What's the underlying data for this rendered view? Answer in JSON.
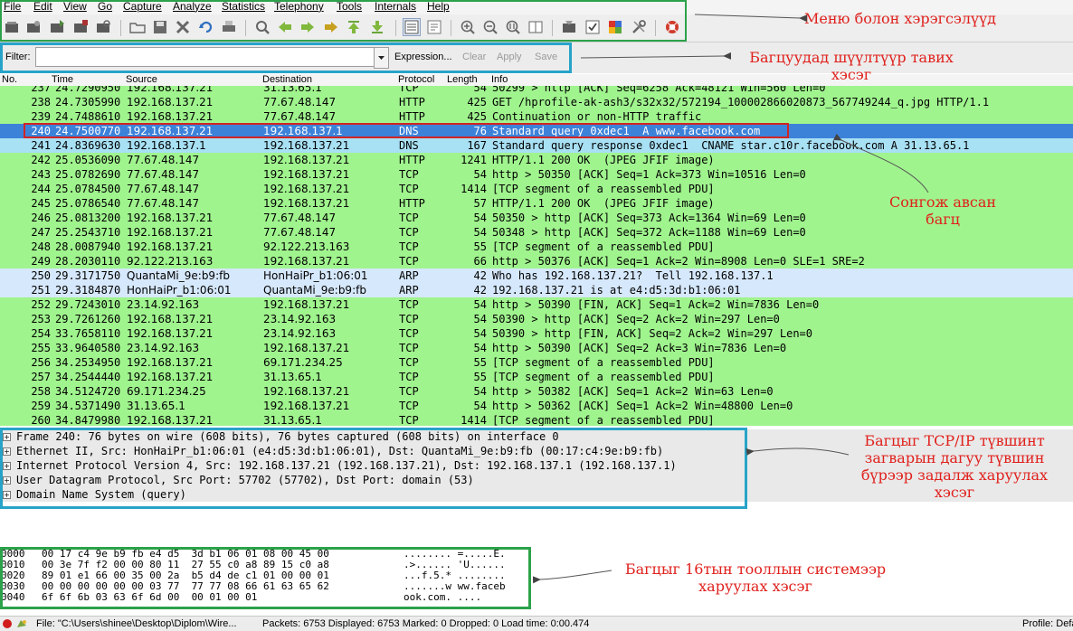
{
  "menu": [
    "File",
    "Edit",
    "View",
    "Go",
    "Capture",
    "Analyze",
    "Statistics",
    "Telephony",
    "Tools",
    "Internals",
    "Help"
  ],
  "toolbar_icons": [
    "interface-list-icon",
    "capture-options-icon",
    "start-capture-icon",
    "stop-capture-icon",
    "restart-capture-icon",
    "open-file-icon",
    "save-file-icon",
    "close-file-icon",
    "reload-icon",
    "print-icon",
    "find-packet-icon",
    "go-back-icon",
    "go-forward-icon",
    "go-to-packet-icon",
    "go-first-icon",
    "go-last-icon",
    "colorize-icon",
    "auto-scroll-icon",
    "zoom-in-icon",
    "zoom-out-icon",
    "zoom-normal-icon",
    "resize-columns-icon",
    "capture-filters-icon",
    "display-filters-icon",
    "coloring-rules-icon",
    "preferences-icon",
    "help-icon"
  ],
  "filter": {
    "label": "Filter:",
    "value": "",
    "expression": "Expression...",
    "clear": "Clear",
    "apply": "Apply",
    "save": "Save"
  },
  "columns": [
    "No.",
    "Time",
    "Source",
    "Destination",
    "Protocol",
    "Length",
    "Info"
  ],
  "packets": [
    {
      "no": "237",
      "time": "24.7290950",
      "src": "192.168.137.21",
      "dst": "31.13.65.1",
      "proto": "TCP",
      "len": "54",
      "info": "50299 > http [ACK] Seq=6258 Ack=48121 Win=560 Len=0",
      "bg": "green"
    },
    {
      "no": "238",
      "time": "24.7305990",
      "src": "192.168.137.21",
      "dst": "77.67.48.147",
      "proto": "HTTP",
      "len": "425",
      "info": "GET /hprofile-ak-ash3/s32x32/572194_100002866020873_567749244_q.jpg HTTP/1.1",
      "bg": "green"
    },
    {
      "no": "239",
      "time": "24.7488610",
      "src": "192.168.137.21",
      "dst": "77.67.48.147",
      "proto": "HTTP",
      "len": "425",
      "info": "Continuation or non-HTTP traffic",
      "bg": "green"
    },
    {
      "no": "240",
      "time": "24.7500770",
      "src": "192.168.137.21",
      "dst": "192.168.137.1",
      "proto": "DNS",
      "len": "76",
      "info": "Standard query 0xdec1  A www.facebook.com",
      "bg": "selected"
    },
    {
      "no": "241",
      "time": "24.8369630",
      "src": "192.168.137.1",
      "dst": "192.168.137.21",
      "proto": "DNS",
      "len": "167",
      "info": "Standard query response 0xdec1  CNAME star.c10r.facebook.com A 31.13.65.1",
      "bg": "cyan"
    },
    {
      "no": "242",
      "time": "25.0536090",
      "src": "77.67.48.147",
      "dst": "192.168.137.21",
      "proto": "HTTP",
      "len": "1241",
      "info": "HTTP/1.1 200 OK  (JPEG JFIF image)",
      "bg": "green"
    },
    {
      "no": "243",
      "time": "25.0782690",
      "src": "77.67.48.147",
      "dst": "192.168.137.21",
      "proto": "TCP",
      "len": "54",
      "info": "http > 50350 [ACK] Seq=1 Ack=373 Win=10516 Len=0",
      "bg": "green"
    },
    {
      "no": "244",
      "time": "25.0784500",
      "src": "77.67.48.147",
      "dst": "192.168.137.21",
      "proto": "TCP",
      "len": "1414",
      "info": "[TCP segment of a reassembled PDU]",
      "bg": "green"
    },
    {
      "no": "245",
      "time": "25.0786540",
      "src": "77.67.48.147",
      "dst": "192.168.137.21",
      "proto": "HTTP",
      "len": "57",
      "info": "HTTP/1.1 200 OK  (JPEG JFIF image)",
      "bg": "green"
    },
    {
      "no": "246",
      "time": "25.0813200",
      "src": "192.168.137.21",
      "dst": "77.67.48.147",
      "proto": "TCP",
      "len": "54",
      "info": "50350 > http [ACK] Seq=373 Ack=1364 Win=69 Len=0",
      "bg": "green"
    },
    {
      "no": "247",
      "time": "25.2543710",
      "src": "192.168.137.21",
      "dst": "77.67.48.147",
      "proto": "TCP",
      "len": "54",
      "info": "50348 > http [ACK] Seq=372 Ack=1188 Win=69 Len=0",
      "bg": "green"
    },
    {
      "no": "248",
      "time": "28.0087940",
      "src": "192.168.137.21",
      "dst": "92.122.213.163",
      "proto": "TCP",
      "len": "55",
      "info": "[TCP segment of a reassembled PDU]",
      "bg": "green"
    },
    {
      "no": "249",
      "time": "28.2030110",
      "src": "92.122.213.163",
      "dst": "192.168.137.21",
      "proto": "TCP",
      "len": "66",
      "info": "http > 50376 [ACK] Seq=1 Ack=2 Win=8908 Len=0 SLE=1 SRE=2",
      "bg": "green"
    },
    {
      "no": "250",
      "time": "29.3171750",
      "src": "QuantaMi_9e:b9:fb",
      "dst": "HonHaiPr_b1:06:01",
      "proto": "ARP",
      "len": "42",
      "info": "Who has 192.168.137.21?  Tell 192.168.137.1",
      "bg": "arp"
    },
    {
      "no": "251",
      "time": "29.3184870",
      "src": "HonHaiPr_b1:06:01",
      "dst": "QuantaMi_9e:b9:fb",
      "proto": "ARP",
      "len": "42",
      "info": "192.168.137.21 is at e4:d5:3d:b1:06:01",
      "bg": "arp"
    },
    {
      "no": "252",
      "time": "29.7243010",
      "src": "23.14.92.163",
      "dst": "192.168.137.21",
      "proto": "TCP",
      "len": "54",
      "info": "http > 50390 [FIN, ACK] Seq=1 Ack=2 Win=7836 Len=0",
      "bg": "green"
    },
    {
      "no": "253",
      "time": "29.7261260",
      "src": "192.168.137.21",
      "dst": "23.14.92.163",
      "proto": "TCP",
      "len": "54",
      "info": "50390 > http [ACK] Seq=2 Ack=2 Win=297 Len=0",
      "bg": "green"
    },
    {
      "no": "254",
      "time": "33.7658110",
      "src": "192.168.137.21",
      "dst": "23.14.92.163",
      "proto": "TCP",
      "len": "54",
      "info": "50390 > http [FIN, ACK] Seq=2 Ack=2 Win=297 Len=0",
      "bg": "green"
    },
    {
      "no": "255",
      "time": "33.9640580",
      "src": "23.14.92.163",
      "dst": "192.168.137.21",
      "proto": "TCP",
      "len": "54",
      "info": "http > 50390 [ACK] Seq=2 Ack=3 Win=7836 Len=0",
      "bg": "green"
    },
    {
      "no": "256",
      "time": "34.2534950",
      "src": "192.168.137.21",
      "dst": "69.171.234.25",
      "proto": "TCP",
      "len": "55",
      "info": "[TCP segment of a reassembled PDU]",
      "bg": "green"
    },
    {
      "no": "257",
      "time": "34.2544440",
      "src": "192.168.137.21",
      "dst": "31.13.65.1",
      "proto": "TCP",
      "len": "55",
      "info": "[TCP segment of a reassembled PDU]",
      "bg": "green"
    },
    {
      "no": "258",
      "time": "34.5124720",
      "src": "69.171.234.25",
      "dst": "192.168.137.21",
      "proto": "TCP",
      "len": "54",
      "info": "http > 50382 [ACK] Seq=1 Ack=2 Win=63 Len=0",
      "bg": "green"
    },
    {
      "no": "259",
      "time": "34.5371490",
      "src": "31.13.65.1",
      "dst": "192.168.137.21",
      "proto": "TCP",
      "len": "54",
      "info": "http > 50362 [ACK] Seq=1 Ack=2 Win=48800 Len=0",
      "bg": "green"
    },
    {
      "no": "260",
      "time": "34.8479980",
      "src": "192.168.137.21",
      "dst": "31.13.65.1",
      "proto": "TCP",
      "len": "1414",
      "info": "[TCP segment of a reassembled PDU]",
      "bg": "green"
    }
  ],
  "details": [
    "Frame 240: 76 bytes on wire (608 bits), 76 bytes captured (608 bits) on interface 0",
    "Ethernet II, Src: HonHaiPr_b1:06:01 (e4:d5:3d:b1:06:01), Dst: QuantaMi_9e:b9:fb (00:17:c4:9e:b9:fb)",
    "Internet Protocol Version 4, Src: 192.168.137.21 (192.168.137.21), Dst: 192.168.137.1 (192.168.137.1)",
    "User Datagram Protocol, Src Port: 57702 (57702), Dst Port: domain (53)",
    "Domain Name System (query)"
  ],
  "bytes": [
    {
      "off": "0000",
      "hex": "00 17 c4 9e b9 fb e4 d5  3d b1 06 01 08 00 45 00",
      "ascii": "........ =.....E."
    },
    {
      "off": "0010",
      "hex": "00 3e 7f f2 00 00 80 11  27 55 c0 a8 89 15 c0 a8",
      "ascii": ".>...... 'U......"
    },
    {
      "off": "0020",
      "hex": "89 01 e1 66 00 35 00 2a  b5 d4 de c1 01 00 00 01",
      "ascii": "...f.5.* ........"
    },
    {
      "off": "0030",
      "hex": "00 00 00 00 00 00 03 77  77 77 08 66 61 63 65 62",
      "ascii": ".......w ww.faceb"
    },
    {
      "off": "0040",
      "hex": "6f 6f 6b 03 63 6f 6d 00  00 01 00 01",
      "ascii": "ook.com. ...."
    }
  ],
  "status": {
    "file": "File: \"C:\\Users\\shinee\\Desktop\\Diplom\\Wire...",
    "packets": "Packets: 6753 Displayed: 6753 Marked: 0 Dropped: 0 Load time: 0:00.474",
    "profile": "Profile: Default"
  },
  "annotations": {
    "menu_toolbar": "Меню болон хэрэгсэлүүд",
    "filter": "Багцуудад шүүлтүүр тавих хэсэг",
    "selected": "Сонгож авсан багц",
    "details": "Багцыг TCP/IP түвшинт загварын дагуу түвшин бүрээр задалж харуулах хэсэг",
    "bytes": "Багцыг 16тын тооллын системээр харуулах хэсэг"
  },
  "colors": {
    "green": "#a0f48e",
    "selected": "#3d82d9",
    "cyan": "#a8e0f4",
    "arp": "#d6e8fb",
    "frame_green": "#2ca24a",
    "frame_blue": "#27a3c9",
    "frame_red": "#d22424",
    "annotation": "#e0211d"
  }
}
